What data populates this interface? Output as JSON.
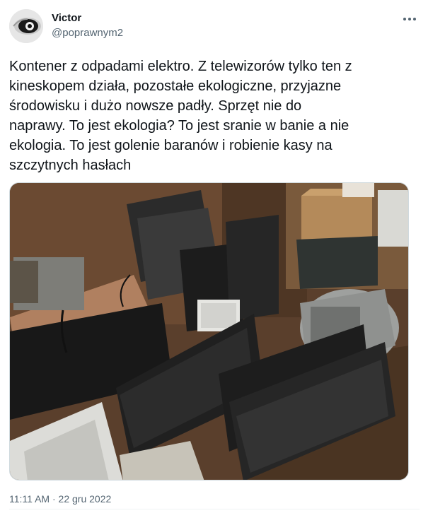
{
  "author": {
    "display_name": "Victor",
    "handle": "@poprawnym2"
  },
  "tweet": {
    "text": "Kontener z odpadami elektro. Z telewizorów tylko ten z\nkineskopem działa, pozostałe ekologiczne, przyjazne\nśrodowisku i dużo nowsze padły. Sprzęt nie do\nnaprawy. To jest ekologia? To jest sranie w banie a nie\nekologia. To jest golenie baranów i robienie kasy na\nszczytnych hasłach"
  },
  "meta": {
    "time": "11:11 AM",
    "separator": "·",
    "date": "22 gru 2022"
  },
  "icons": {
    "avatar": "avatar-image",
    "more": "more-options-icon"
  },
  "colors": {
    "text_primary": "#0f1419",
    "text_secondary": "#536471",
    "border": "#cfd9de"
  }
}
